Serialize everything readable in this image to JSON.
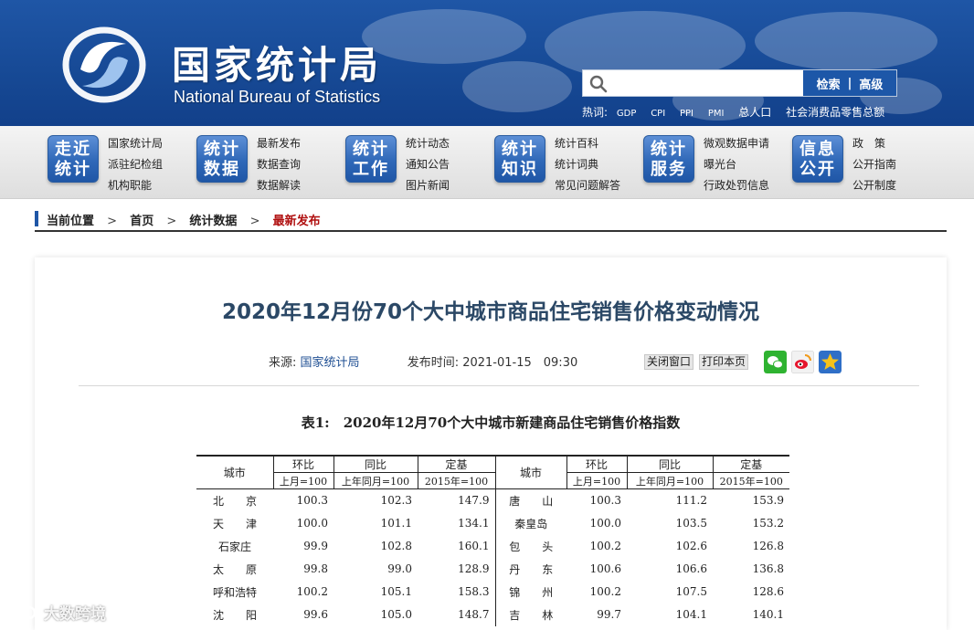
{
  "header": {
    "logo_cn": "国家统计局",
    "logo_en": "National Bureau of Statistics",
    "search": {
      "placeholder": "",
      "btn_search": "检索",
      "btn_sep": "|",
      "btn_advanced": "高级"
    },
    "hotwords": {
      "label": "热词:",
      "items": [
        "GDP",
        "CPI",
        "PPI",
        "PMI",
        "总人口",
        "社会消费品零售总额"
      ]
    }
  },
  "nav": [
    {
      "badge": [
        "走近",
        "统计"
      ],
      "links": [
        "国家统计局",
        "派驻纪检组",
        "机构职能"
      ]
    },
    {
      "badge": [
        "统计",
        "数据"
      ],
      "links": [
        "最新发布",
        "数据查询",
        "数据解读"
      ]
    },
    {
      "badge": [
        "统计",
        "工作"
      ],
      "links": [
        "统计动态",
        "通知公告",
        "图片新闻"
      ]
    },
    {
      "badge": [
        "统计",
        "知识"
      ],
      "links": [
        "统计百科",
        "统计词典",
        "常见问题解答"
      ]
    },
    {
      "badge": [
        "统计",
        "服务"
      ],
      "links": [
        "微观数据申请",
        "曝光台",
        "行政处罚信息"
      ]
    },
    {
      "badge": [
        "信息",
        "公开"
      ],
      "links": [
        "政　策",
        "公开指南",
        "公开制度"
      ]
    }
  ],
  "breadcrumb": {
    "label": "当前位置",
    "arrow": ">",
    "items": [
      "首页",
      "统计数据",
      "最新发布"
    ]
  },
  "article": {
    "title": "2020年12月份70个大中城市商品住宅销售价格变动情况",
    "source_label": "来源:",
    "source": "国家统计局",
    "time_label": "发布时间:",
    "time": "2021-01-15　09:30",
    "close_btn": "关闭窗口",
    "print_btn": "打印本页"
  },
  "table": {
    "caption": "表1:　2020年12月70个大中城市新建商品住宅销售价格指数",
    "col_city": "城市",
    "groups": [
      "环比",
      "同比",
      "定基"
    ],
    "subs": [
      "上月=100",
      "上年同月=100",
      "2015年=100"
    ],
    "rows": [
      {
        "c1": "北　　京",
        "a": "100.3",
        "b": "102.3",
        "d": "147.9",
        "c2": "唐　　山",
        "e": "100.3",
        "f": "111.2",
        "g": "153.9"
      },
      {
        "c1": "天　　津",
        "a": "100.0",
        "b": "101.1",
        "d": "134.1",
        "c2": "秦皇岛",
        "e": "100.0",
        "f": "103.5",
        "g": "153.2"
      },
      {
        "c1": "石家庄",
        "a": "99.9",
        "b": "102.8",
        "d": "160.1",
        "c2": "包　　头",
        "e": "100.2",
        "f": "102.6",
        "g": "126.8"
      },
      {
        "c1": "太　　原",
        "a": "99.8",
        "b": "99.0",
        "d": "128.9",
        "c2": "丹　　东",
        "e": "100.6",
        "f": "106.6",
        "g": "136.8"
      },
      {
        "c1": "呼和浩特",
        "a": "100.2",
        "b": "105.1",
        "d": "158.3",
        "c2": "锦　　州",
        "e": "100.2",
        "f": "107.5",
        "g": "128.6"
      },
      {
        "c1": "沈　　阳",
        "a": "99.6",
        "b": "105.0",
        "d": "148.7",
        "c2": "吉　　林",
        "e": "99.7",
        "f": "104.1",
        "g": "140.1"
      }
    ]
  },
  "watermark": "大数跨境"
}
